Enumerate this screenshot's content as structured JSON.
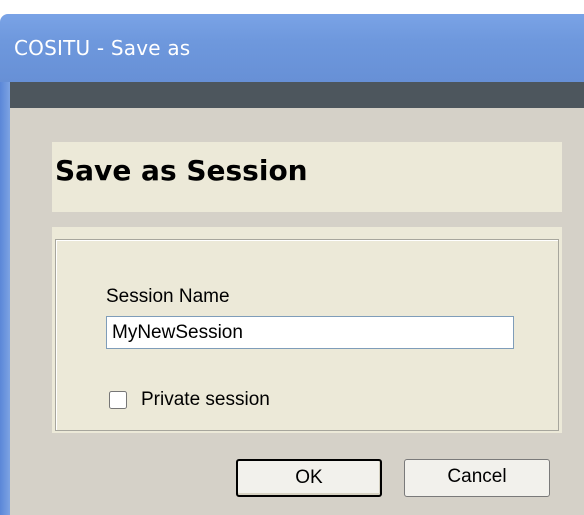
{
  "window": {
    "title": "COSITU - Save as"
  },
  "header": {
    "title": "Save as Session"
  },
  "form": {
    "session_name_label": "Session Name",
    "session_name_value": "MyNewSession",
    "private_label": "Private session",
    "private_checked": false
  },
  "buttons": {
    "ok_label": "OK",
    "cancel_label": "Cancel"
  },
  "colors": {
    "titlebar": "#6e98dd",
    "dark_band": "#4d565d",
    "dialog_bg": "#d5d1c8",
    "panel_bg": "#ece9d8"
  }
}
